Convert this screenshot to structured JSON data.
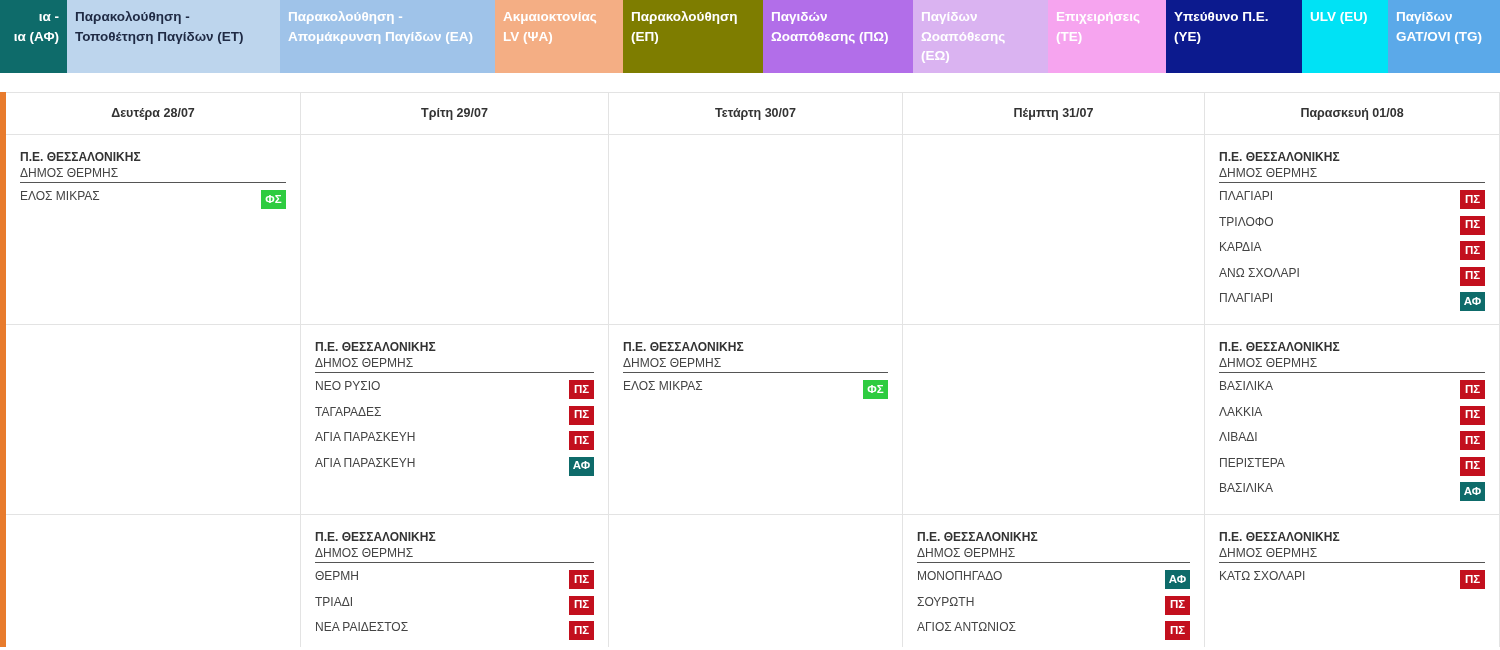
{
  "legend": [
    {
      "lines": [
        "ια -",
        "ια (ΑΦ)"
      ],
      "color": "#0e6b6a",
      "dark_text": false
    },
    {
      "lines": [
        "Παρακολούθηση -",
        "Τοποθέτηση Παγίδων (ΕΤ)"
      ],
      "color": "#bdd5ed",
      "dark_text": true
    },
    {
      "lines": [
        "Παρακολούθηση -",
        "Απομάκρυνση Παγίδων (ΕΑ)"
      ],
      "color": "#9fc3e9",
      "dark_text": false
    },
    {
      "lines": [
        "Ακμαιοκτονίας",
        "LV (ΨΑ)"
      ],
      "color": "#f4ae84",
      "dark_text": false
    },
    {
      "lines": [
        "Παρακολούθηση",
        "(ΕΠ)"
      ],
      "color": "#7e7d00",
      "dark_text": false
    },
    {
      "lines": [
        "Παγιδών",
        "Ωοαπόθεσης (ΠΩ)"
      ],
      "color": "#b26ee9",
      "dark_text": false
    },
    {
      "lines": [
        "Παγίδων",
        "Ωοαπόθεσης",
        "(ΕΩ)"
      ],
      "color": "#dab3f1",
      "dark_text": false
    },
    {
      "lines": [
        "Επιχειρήσεις",
        "(ΤΕ)"
      ],
      "color": "#f6a4ef",
      "dark_text": false
    },
    {
      "lines": [
        "Υπεύθυνο Π.Ε.",
        "(ΥΕ)"
      ],
      "color": "#0c1a8e",
      "dark_text": false
    },
    {
      "lines": [
        "ULV (EU)"
      ],
      "color": "#00e2f5",
      "dark_text": false
    },
    {
      "lines": [
        "Παγίδων",
        "GAT/OVI (TG)"
      ],
      "color": "#5ba9e9",
      "dark_text": false
    }
  ],
  "days": [
    "Δευτέρα 28/07",
    "Τρίτη 29/07",
    "Τετάρτη 30/07",
    "Πέμπτη 31/07",
    "Παρασκευή 01/08"
  ],
  "rows": [
    [
      {
        "region": "Π.Ε. ΘΕΣΣΑΛΟΝΙΚΗΣ",
        "municipality": "ΔΗΜΟΣ ΘΕΡΜΗΣ",
        "entries": [
          {
            "place": "ΕΛΟΣ ΜΙΚΡΑΣ",
            "code": "ΦΣ",
            "color": "#2ecc40"
          }
        ]
      },
      null,
      null,
      null,
      {
        "region": "Π.Ε. ΘΕΣΣΑΛΟΝΙΚΗΣ",
        "municipality": "ΔΗΜΟΣ ΘΕΡΜΗΣ",
        "entries": [
          {
            "place": "ΠΛΑΓΙΑΡΙ",
            "code": "ΠΣ",
            "color": "#c3101e"
          },
          {
            "place": "ΤΡΙΛΟΦΟ",
            "code": "ΠΣ",
            "color": "#c3101e"
          },
          {
            "place": "ΚΑΡΔΙΑ",
            "code": "ΠΣ",
            "color": "#c3101e"
          },
          {
            "place": "ΑΝΩ ΣΧΟΛΑΡΙ",
            "code": "ΠΣ",
            "color": "#c3101e"
          },
          {
            "place": "ΠΛΑΓΙΑΡΙ",
            "code": "ΑΦ",
            "color": "#0e6b6a"
          }
        ]
      }
    ],
    [
      null,
      {
        "region": "Π.Ε. ΘΕΣΣΑΛΟΝΙΚΗΣ",
        "municipality": "ΔΗΜΟΣ ΘΕΡΜΗΣ",
        "entries": [
          {
            "place": "ΝΕΟ ΡΥΣΙΟ",
            "code": "ΠΣ",
            "color": "#c3101e"
          },
          {
            "place": "ΤΑΓΑΡΑΔΕΣ",
            "code": "ΠΣ",
            "color": "#c3101e"
          },
          {
            "place": "ΑΓΙΑ ΠΑΡΑΣΚΕΥΗ",
            "code": "ΠΣ",
            "color": "#c3101e"
          },
          {
            "place": "ΑΓΙΑ ΠΑΡΑΣΚΕΥΗ",
            "code": "ΑΦ",
            "color": "#0e6b6a"
          }
        ]
      },
      {
        "region": "Π.Ε. ΘΕΣΣΑΛΟΝΙΚΗΣ",
        "municipality": "ΔΗΜΟΣ ΘΕΡΜΗΣ",
        "entries": [
          {
            "place": "ΕΛΟΣ ΜΙΚΡΑΣ",
            "code": "ΦΣ",
            "color": "#2ecc40"
          }
        ]
      },
      null,
      {
        "region": "Π.Ε. ΘΕΣΣΑΛΟΝΙΚΗΣ",
        "municipality": "ΔΗΜΟΣ ΘΕΡΜΗΣ",
        "entries": [
          {
            "place": "ΒΑΣΙΛΙΚΑ",
            "code": "ΠΣ",
            "color": "#c3101e"
          },
          {
            "place": "ΛΑΚΚΙΑ",
            "code": "ΠΣ",
            "color": "#c3101e"
          },
          {
            "place": "ΛΙΒΑΔΙ",
            "code": "ΠΣ",
            "color": "#c3101e"
          },
          {
            "place": "ΠΕΡΙΣΤΕΡΑ",
            "code": "ΠΣ",
            "color": "#c3101e"
          },
          {
            "place": "ΒΑΣΙΛΙΚΑ",
            "code": "ΑΦ",
            "color": "#0e6b6a"
          }
        ]
      }
    ],
    [
      null,
      {
        "region": "Π.Ε. ΘΕΣΣΑΛΟΝΙΚΗΣ",
        "municipality": "ΔΗΜΟΣ ΘΕΡΜΗΣ",
        "entries": [
          {
            "place": "ΘΕΡΜΗ",
            "code": "ΠΣ",
            "color": "#c3101e"
          },
          {
            "place": "ΤΡΙΑΔΙ",
            "code": "ΠΣ",
            "color": "#c3101e"
          },
          {
            "place": "ΝΕΑ ΡΑΙΔΕΣΤΟΣ",
            "code": "ΠΣ",
            "color": "#c3101e"
          }
        ]
      },
      null,
      {
        "region": "Π.Ε. ΘΕΣΣΑΛΟΝΙΚΗΣ",
        "municipality": "ΔΗΜΟΣ ΘΕΡΜΗΣ",
        "entries": [
          {
            "place": "ΜΟΝΟΠΗΓΑΔΟ",
            "code": "ΑΦ",
            "color": "#0e6b6a"
          },
          {
            "place": "ΣΟΥΡΩΤΗ",
            "code": "ΠΣ",
            "color": "#c3101e"
          },
          {
            "place": "ΑΓΙΟΣ ΑΝΤΩΝΙΟΣ",
            "code": "ΠΣ",
            "color": "#c3101e"
          }
        ]
      },
      {
        "region": "Π.Ε. ΘΕΣΣΑΛΟΝΙΚΗΣ",
        "municipality": "ΔΗΜΟΣ ΘΕΡΜΗΣ",
        "entries": [
          {
            "place": "ΚΑΤΩ ΣΧΟΛΑΡΙ",
            "code": "ΠΣ",
            "color": "#c3101e"
          }
        ]
      }
    ]
  ]
}
